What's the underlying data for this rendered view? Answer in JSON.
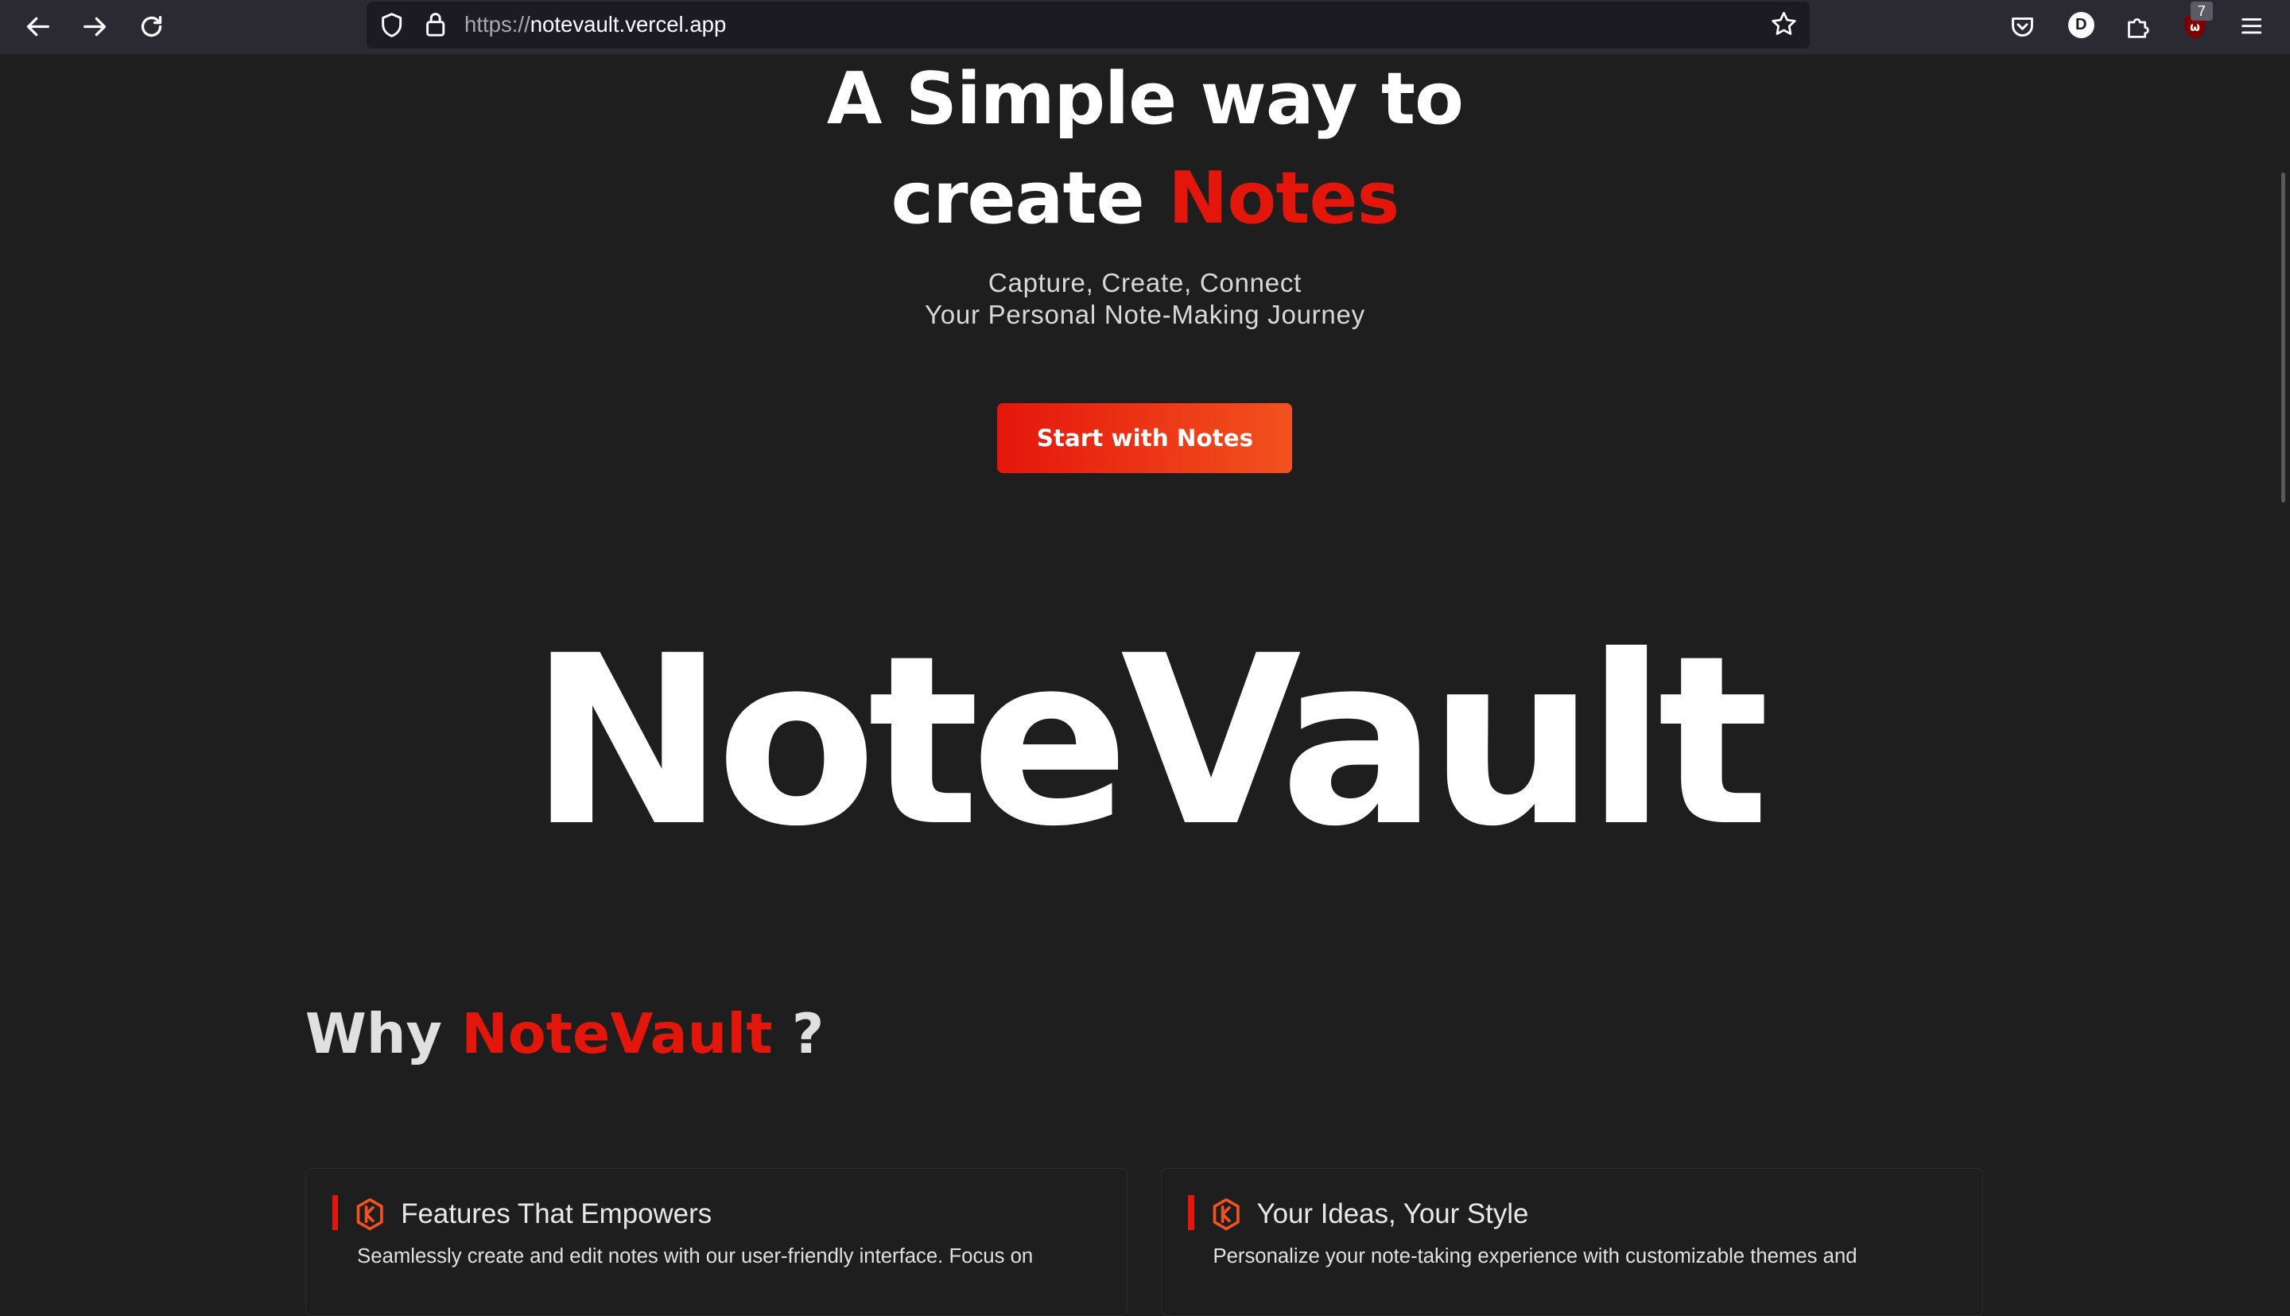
{
  "browser": {
    "url_protocol": "https://",
    "url_host": "notevault.vercel.app",
    "profile_initial": "D",
    "extension_badge": "7",
    "icons": [
      "back-arrow-icon",
      "forward-arrow-icon",
      "reload-icon",
      "shield-icon",
      "lock-icon",
      "bookmark-star-icon",
      "pocket-icon",
      "profile-icon",
      "extensions-puzzle-icon",
      "ublock-icon",
      "hamburger-menu-icon"
    ]
  },
  "hero": {
    "line1": "A Simple way to",
    "line2_prefix": "create",
    "line2_accent": "Notes",
    "tagline1": "Capture, Create, Connect",
    "tagline2": "Your Personal Note-Making Journey",
    "cta_label": "Start with Notes"
  },
  "brand": "NoteVault",
  "why": {
    "prefix": "Why",
    "accent": "NoteVault",
    "suffix": "?"
  },
  "cards": [
    {
      "title": "Features That Empowers",
      "description": "Seamlessly create and edit notes with our user-friendly interface. Focus on",
      "icon": "hexagon-logo-icon"
    },
    {
      "title": "Your Ideas, Your Style",
      "description": "Personalize your note-taking experience with customizable themes and",
      "icon": "hexagon-logo-icon"
    }
  ],
  "colors": {
    "accent": "#e3160c",
    "background": "#1e1e1e",
    "toolbar": "#2b2a33",
    "cta_gradient_start": "#e5160c",
    "cta_gradient_end": "#f2521e"
  }
}
